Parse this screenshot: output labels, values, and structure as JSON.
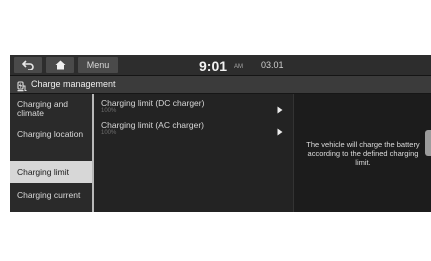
{
  "topbar": {
    "menu_label": "Menu",
    "time": "9:01",
    "ampm": "AM",
    "date": "03.01"
  },
  "header": {
    "title": "Charge management"
  },
  "sidebar": {
    "items": [
      {
        "label": "Charging and climate",
        "active": false
      },
      {
        "label": "Charging location",
        "active": false
      },
      {
        "label": "Charging limit",
        "active": true
      },
      {
        "label": "Charging current",
        "active": false
      }
    ]
  },
  "main": {
    "rows": [
      {
        "label": "Charging limit (DC charger)",
        "value": "100%"
      },
      {
        "label": "Charging limit (AC charger)",
        "value": "100%"
      }
    ],
    "info_text": "The vehicle will charge the battery according to the defined charging limit."
  }
}
